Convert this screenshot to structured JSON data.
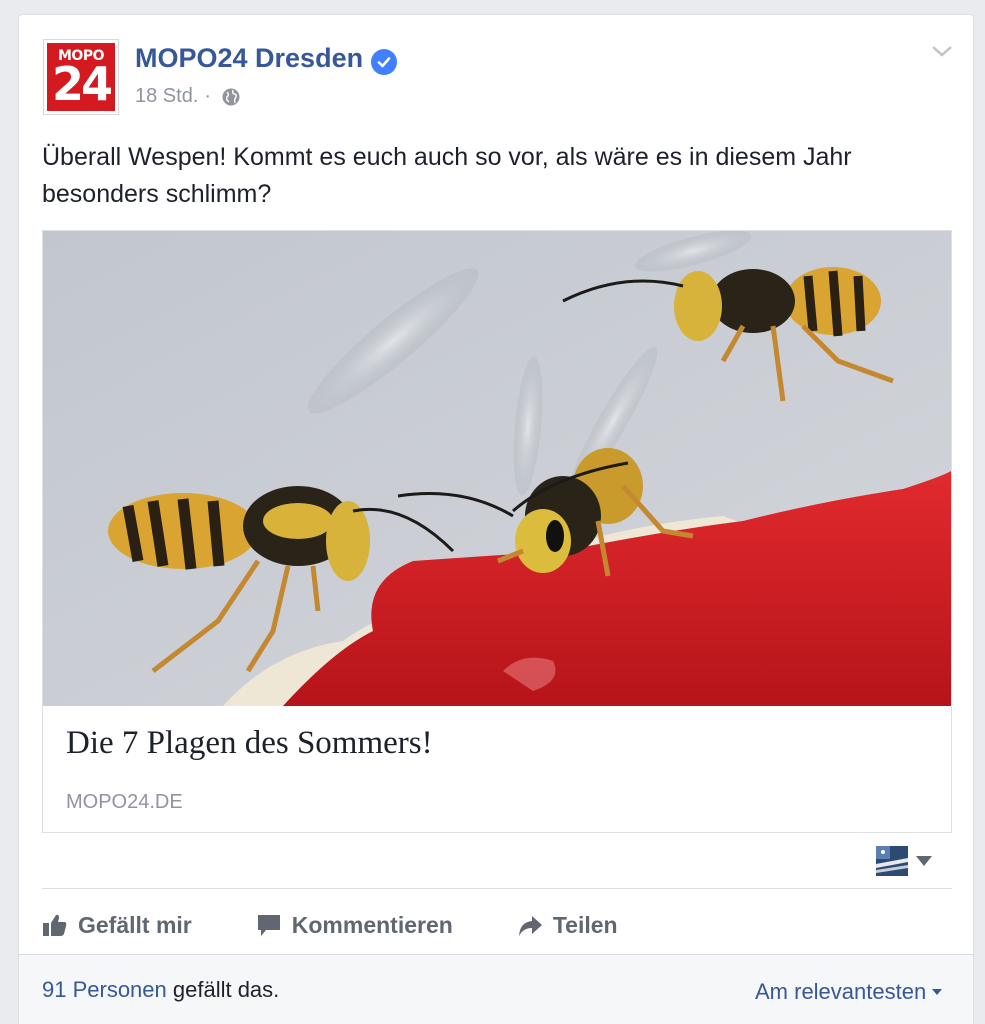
{
  "post": {
    "logo": {
      "top_text": "MOPO",
      "number": "24"
    },
    "page_name": "MOPO24 Dresden",
    "timestamp": "18 Std.",
    "separator": "·",
    "text_line1": "Überall Wespen! Kommt es euch auch so vor, als wäre es in diesem Jahr",
    "text_line2": "besonders schlimm?"
  },
  "link": {
    "image_description_icon": "wasps-on-jam-photo",
    "title": "Die 7 Plagen des Sommers!",
    "domain": "MOPO24.DE"
  },
  "actions": {
    "like_label": "Gefällt mir",
    "comment_label": "Kommentieren",
    "share_label": "Teilen"
  },
  "footer": {
    "likes_count": "91 Personen",
    "likes_suffix": " gefällt das.",
    "sort_label": "Am relevantesten"
  },
  "colors": {
    "brand_link": "#365899",
    "logo_red": "#d41920",
    "verified_blue": "#4080ff",
    "muted": "#90949c",
    "background": "#e9ebee"
  },
  "icons": [
    "verified-badge-icon",
    "globe-icon",
    "chevron-down-icon",
    "thumbs-up-icon",
    "comment-icon",
    "share-arrow-icon",
    "audience-flag-icon",
    "caret-down-icon"
  ]
}
